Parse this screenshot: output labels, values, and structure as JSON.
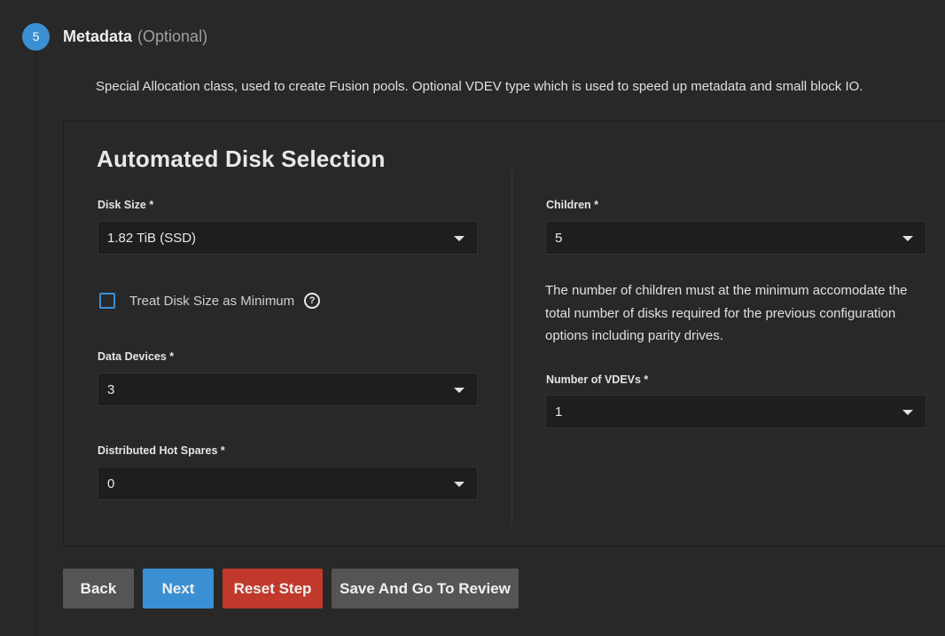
{
  "step": {
    "number": "5",
    "title": "Metadata",
    "optional": "(Optional)",
    "description": "Special Allocation class, used to create Fusion pools. Optional VDEV type which is used to speed up metadata and small block IO."
  },
  "panel": {
    "title": "Automated Disk Selection",
    "left": {
      "disk_size": {
        "label": "Disk Size *",
        "value": "1.82 TiB (SSD)"
      },
      "treat_minimum": {
        "label": "Treat Disk Size as Minimum",
        "checked": false,
        "help_icon": "help-circle-icon"
      },
      "data_devices": {
        "label": "Data Devices *",
        "value": "3"
      },
      "hot_spares": {
        "label": "Distributed Hot Spares *",
        "value": "0"
      }
    },
    "right": {
      "children": {
        "label": "Children *",
        "value": "5"
      },
      "hint": "The number of children must at the minimum accomodate the total number of disks required for the previous configuration options including parity drives.",
      "vdevs": {
        "label": "Number of VDEVs *",
        "value": "1"
      }
    }
  },
  "buttons": {
    "back": "Back",
    "next": "Next",
    "reset": "Reset Step",
    "save_review": "Save And Go To Review"
  },
  "colors": {
    "accent": "#3b90d4",
    "danger": "#c0392b",
    "neutral_button": "#555555",
    "background": "#282828"
  }
}
